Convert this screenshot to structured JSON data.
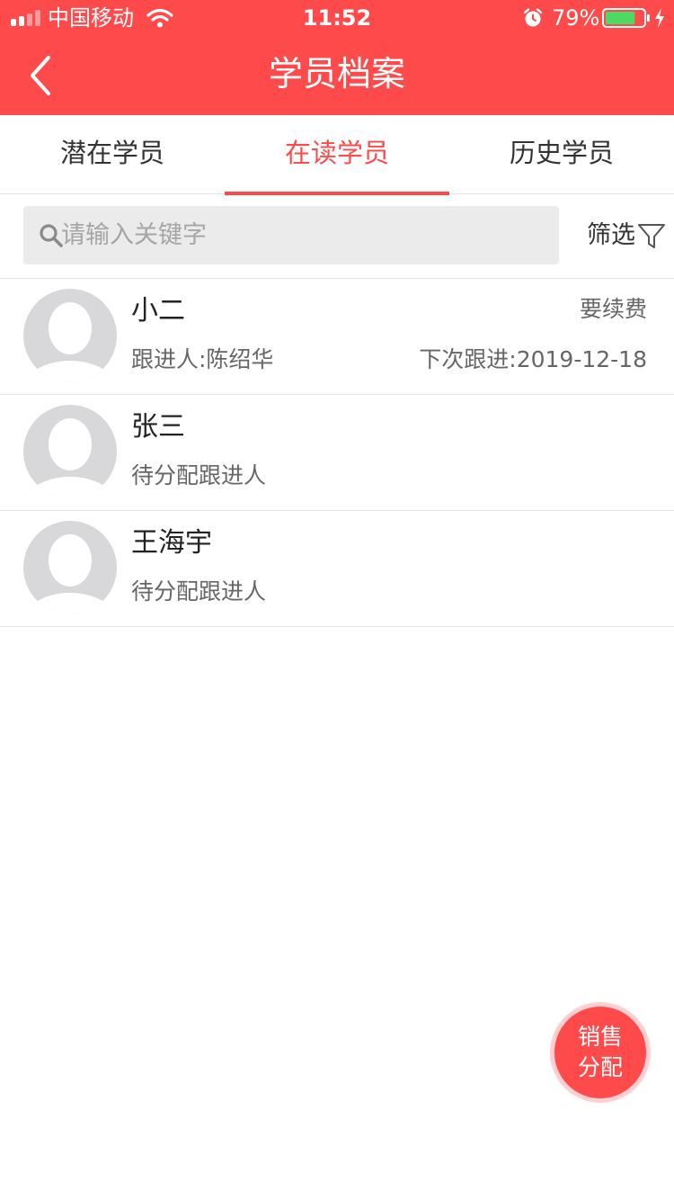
{
  "status_bar": {
    "carrier": "中国移动",
    "time": "11:52",
    "battery": "79%",
    "battery_level": 0.79
  },
  "nav": {
    "title": "学员档案"
  },
  "tabs": [
    {
      "label": "潜在学员",
      "active": false
    },
    {
      "label": "在读学员",
      "active": true
    },
    {
      "label": "历史学员",
      "active": false
    }
  ],
  "search": {
    "placeholder": "请输入关键字",
    "value": ""
  },
  "filter": {
    "label": "筛选"
  },
  "students": [
    {
      "name": "小二",
      "follow": "跟进人:陈绍华",
      "tag": "要续费",
      "next": "下次跟进:2019-12-18"
    },
    {
      "name": "张三",
      "follow": "待分配跟进人",
      "tag": "",
      "next": ""
    },
    {
      "name": "王海宇",
      "follow": "待分配跟进人",
      "tag": "",
      "next": ""
    }
  ],
  "fab": {
    "line1": "销售",
    "line2": "分配"
  },
  "colors": {
    "primary": "#ff4a4c",
    "avatar": "#d8d8da",
    "battery": "#4cd964"
  },
  "icons": {
    "signal": "signal-icon",
    "wifi": "wifi-icon",
    "alarm": "alarm-icon",
    "battery": "battery-icon",
    "charging": "bolt-icon",
    "back": "chevron-left-icon",
    "search": "search-icon",
    "filter": "filter-icon",
    "avatar": "avatar-placeholder-icon"
  }
}
